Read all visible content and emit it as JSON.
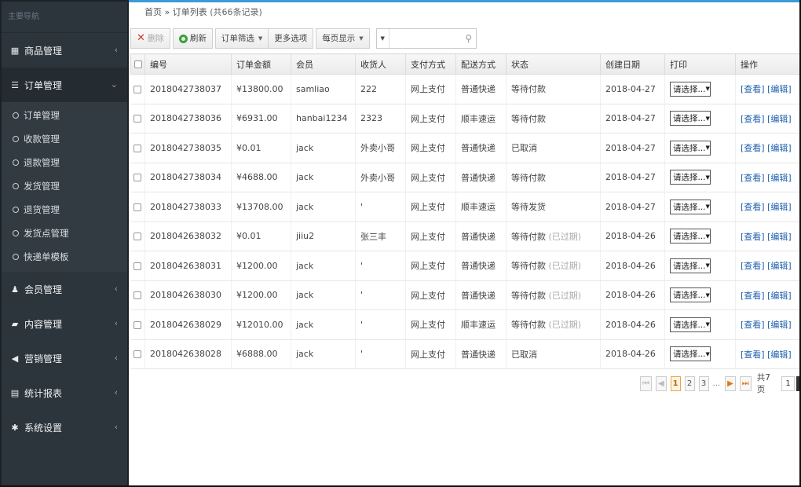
{
  "sidebar": {
    "brand": "主要导航",
    "items": [
      {
        "name": "product",
        "icon": "grid-icon",
        "glyph": "▦",
        "label": "商品管理",
        "chev": "‹"
      },
      {
        "name": "order",
        "icon": "list-icon",
        "glyph": "☰",
        "label": "订单管理",
        "chev": "⌄"
      },
      {
        "name": "member",
        "icon": "user-icon",
        "glyph": "♟",
        "label": "会员管理",
        "chev": "‹"
      },
      {
        "name": "content",
        "icon": "folder-icon",
        "glyph": "▰",
        "label": "内容管理",
        "chev": "‹"
      },
      {
        "name": "marketing",
        "icon": "megaphone-icon",
        "glyph": "◀",
        "label": "营销管理",
        "chev": "‹"
      },
      {
        "name": "reports",
        "icon": "report-icon",
        "glyph": "▤",
        "label": "统计报表",
        "chev": "‹"
      },
      {
        "name": "settings",
        "icon": "gear-icon",
        "glyph": "✱",
        "label": "系统设置",
        "chev": "‹"
      }
    ],
    "order_sub": [
      "订单管理",
      "收款管理",
      "退款管理",
      "发货管理",
      "退货管理",
      "发货点管理",
      "快递单模板"
    ]
  },
  "breadcrumb": {
    "home": "首页",
    "sep": " » ",
    "current": "订单列表",
    "count": "(共66条记录)"
  },
  "toolbar": {
    "delete_label": "删除",
    "refresh_label": "刷新",
    "filter_label": "订单筛选",
    "more_label": "更多选项",
    "per_page_label": "每页显示",
    "search_value": ""
  },
  "table": {
    "headers": [
      "编号",
      "订单金额",
      "会员",
      "收货人",
      "支付方式",
      "配送方式",
      "状态",
      "创建日期",
      "打印",
      "操作"
    ],
    "print_label": "请选择...",
    "view_label": "[查看]",
    "edit_label": "[编辑]",
    "rows": [
      {
        "sn": "2018042738037",
        "amount": "¥13800.00",
        "member": "samliao",
        "consignee": "222",
        "pay": "网上支付",
        "ship": "普通快递",
        "status": "等待付款",
        "expired": "",
        "date": "2018-04-27"
      },
      {
        "sn": "2018042738036",
        "amount": "¥6931.00",
        "member": "hanbai1234",
        "consignee": "2323",
        "pay": "网上支付",
        "ship": "顺丰速运",
        "status": "等待付款",
        "expired": "",
        "date": "2018-04-27"
      },
      {
        "sn": "2018042738035",
        "amount": "¥0.01",
        "member": "jack",
        "consignee": "外卖小哥",
        "pay": "网上支付",
        "ship": "普通快递",
        "status": "已取消",
        "expired": "",
        "date": "2018-04-27"
      },
      {
        "sn": "2018042738034",
        "amount": "¥4688.00",
        "member": "jack",
        "consignee": "外卖小哥",
        "pay": "网上支付",
        "ship": "普通快递",
        "status": "等待付款",
        "expired": "",
        "date": "2018-04-27"
      },
      {
        "sn": "2018042738033",
        "amount": "¥13708.00",
        "member": "jack",
        "consignee": "'",
        "pay": "网上支付",
        "ship": "顺丰速运",
        "status": "等待发货",
        "expired": "",
        "date": "2018-04-27"
      },
      {
        "sn": "2018042638032",
        "amount": "¥0.01",
        "member": "jiiu2",
        "consignee": "张三丰",
        "pay": "网上支付",
        "ship": "普通快递",
        "status": "等待付款",
        "expired": "(已过期)",
        "date": "2018-04-26"
      },
      {
        "sn": "2018042638031",
        "amount": "¥1200.00",
        "member": "jack",
        "consignee": "'",
        "pay": "网上支付",
        "ship": "普通快递",
        "status": "等待付款",
        "expired": "(已过期)",
        "date": "2018-04-26"
      },
      {
        "sn": "2018042638030",
        "amount": "¥1200.00",
        "member": "jack",
        "consignee": "'",
        "pay": "网上支付",
        "ship": "普通快递",
        "status": "等待付款",
        "expired": "(已过期)",
        "date": "2018-04-26"
      },
      {
        "sn": "2018042638029",
        "amount": "¥12010.00",
        "member": "jack",
        "consignee": "'",
        "pay": "网上支付",
        "ship": "顺丰速运",
        "status": "等待付款",
        "expired": "(已过期)",
        "date": "2018-04-26"
      },
      {
        "sn": "2018042638028",
        "amount": "¥6888.00",
        "member": "jack",
        "consignee": "'",
        "pay": "网上支付",
        "ship": "普通快递",
        "status": "已取消",
        "expired": "",
        "date": "2018-04-26"
      }
    ]
  },
  "pager": {
    "pages": [
      "1",
      "2",
      "3"
    ],
    "current": "1",
    "ellipsis": "...",
    "total_label": "共7页",
    "jump_value": "1"
  },
  "colors": {
    "sidebar_bg": "#2d353c",
    "accent_blue": "#3b9bd5",
    "link": "#1f5fae",
    "pager_active": "#e8a64a"
  }
}
